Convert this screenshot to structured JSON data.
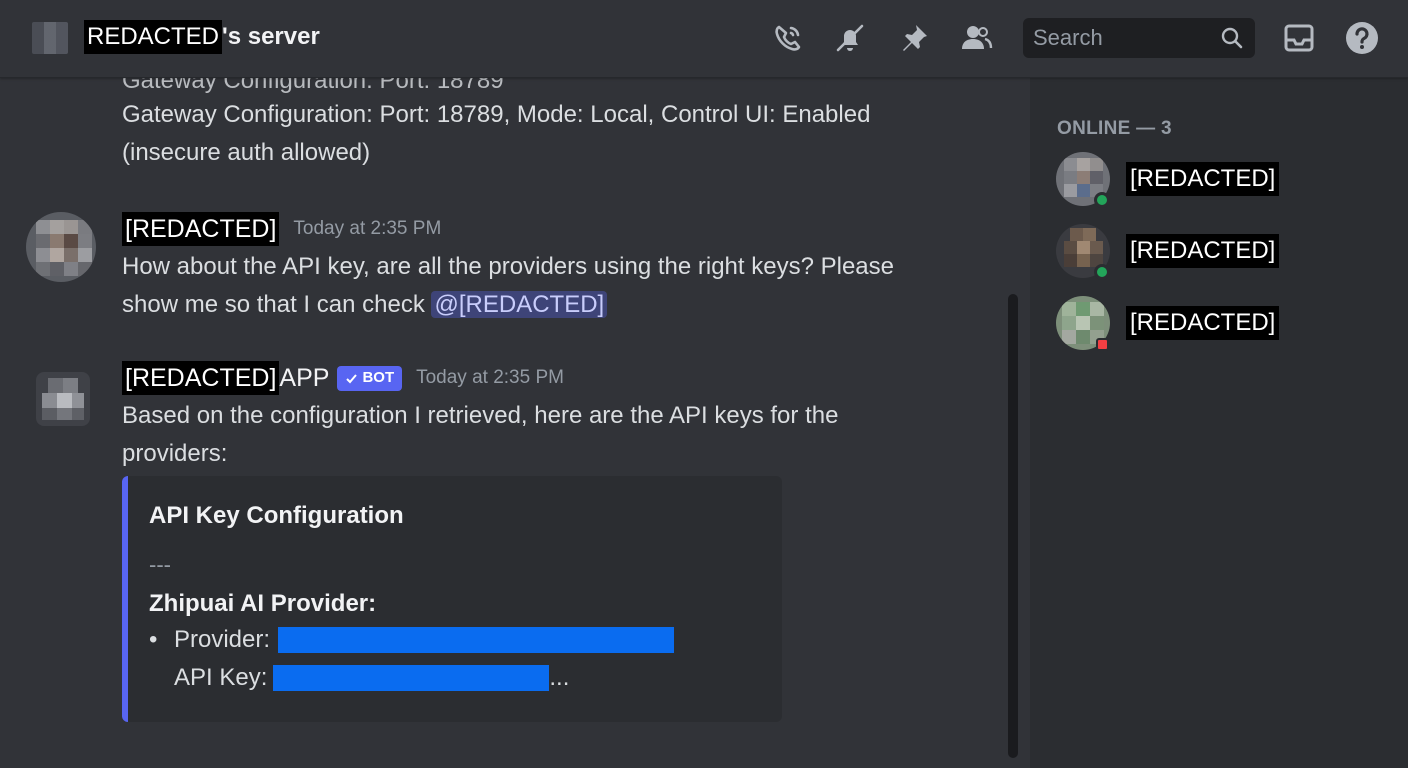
{
  "header": {
    "server_name_redacted": "REDACTED",
    "server_name_suffix": "'s server",
    "search_placeholder": "Search"
  },
  "chat": {
    "prev_message_line0": "Gateway Configuration: Port: 18789",
    "prev_message_line1": "Gateway Configuration: Port: 18789, Mode: Local, Control UI: Enabled",
    "prev_message_line2": "(insecure auth allowed)",
    "messages": [
      {
        "author": "[REDACTED]",
        "timestamp": "Today at 2:35 PM",
        "line1": "How about the API key, are all the providers using the right keys? Please",
        "line2": "show me so that I can check ",
        "mention": "@[REDACTED]"
      },
      {
        "author": "[REDACTED]",
        "author_suffix": " APP",
        "badge": "BOT",
        "timestamp": "Today at 2:35 PM",
        "line1": "Based on the configuration I retrieved, here are the API keys for the",
        "line2": "providers:"
      }
    ],
    "embed": {
      "title": "API Key Configuration",
      "separator": "---",
      "subtitle": "Zhipuai AI Provider:",
      "bullet": "•",
      "provider_label": "Provider:",
      "api_key_label": "API Key:",
      "api_key_ellipsis": "..."
    }
  },
  "members": {
    "heading": "ONLINE — 3",
    "list": [
      {
        "name": "[REDACTED]",
        "status": "online",
        "status_color": "#23a55a"
      },
      {
        "name": "[REDACTED]",
        "status": "online",
        "status_color": "#23a55a"
      },
      {
        "name": "[REDACTED]",
        "status": "dnd",
        "status_color": "#f23f43"
      }
    ]
  },
  "colors": {
    "background": "#313338",
    "sidebar": "#2b2d31",
    "accent": "#5865f2",
    "redaction_blue": "#0a6cf0"
  }
}
